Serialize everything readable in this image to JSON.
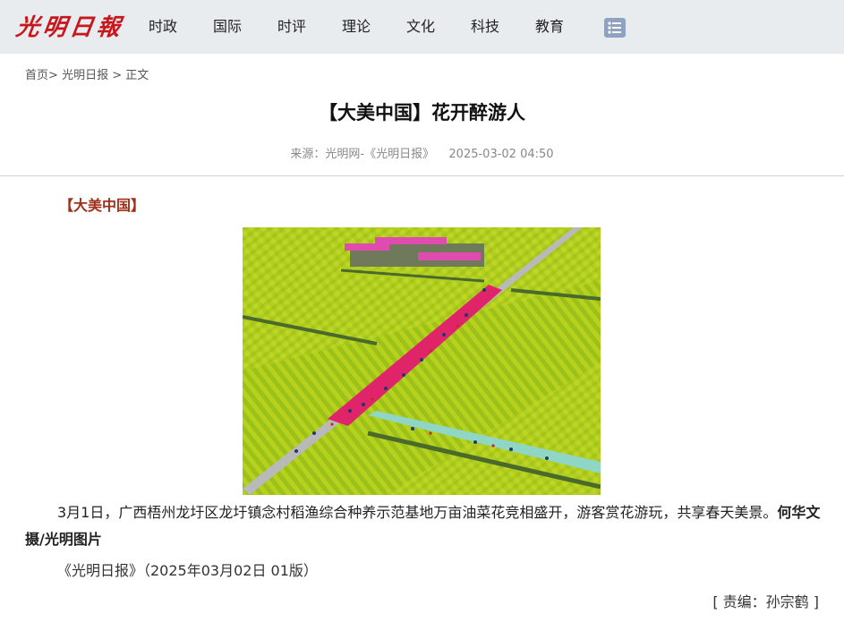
{
  "header": {
    "logo_text": "光明日報",
    "nav": [
      "时政",
      "国际",
      "时评",
      "理论",
      "文化",
      "科技",
      "教育"
    ],
    "menu_icon": "list-menu-icon"
  },
  "breadcrumb": {
    "home": "首页",
    "sep1": ">",
    "section": "光明日报",
    "sep2": ">",
    "current": "正文"
  },
  "article": {
    "title": "【大美中国】花开醉游人",
    "source": "来源：光明网-《光明日报》",
    "datetime": "2025-03-02 04:50",
    "column_tag": "【大美中国】",
    "caption": "3月1日，广西梧州龙圩区龙圩镇念村稻渔综合种养示范基地万亩油菜花竞相盛开，游客赏花游玩，共享春天美景。",
    "credit": "何华文摄/光明图片",
    "publication": "《光明日报》（2025年03月02日 01版）",
    "editor": "[ 责编：孙宗鹤 ]"
  },
  "colors": {
    "logo_red": "#c8161d",
    "header_bg": "#e9ecef",
    "column_tag": "#a0301a",
    "menu_icon": "#8ea3c2"
  }
}
